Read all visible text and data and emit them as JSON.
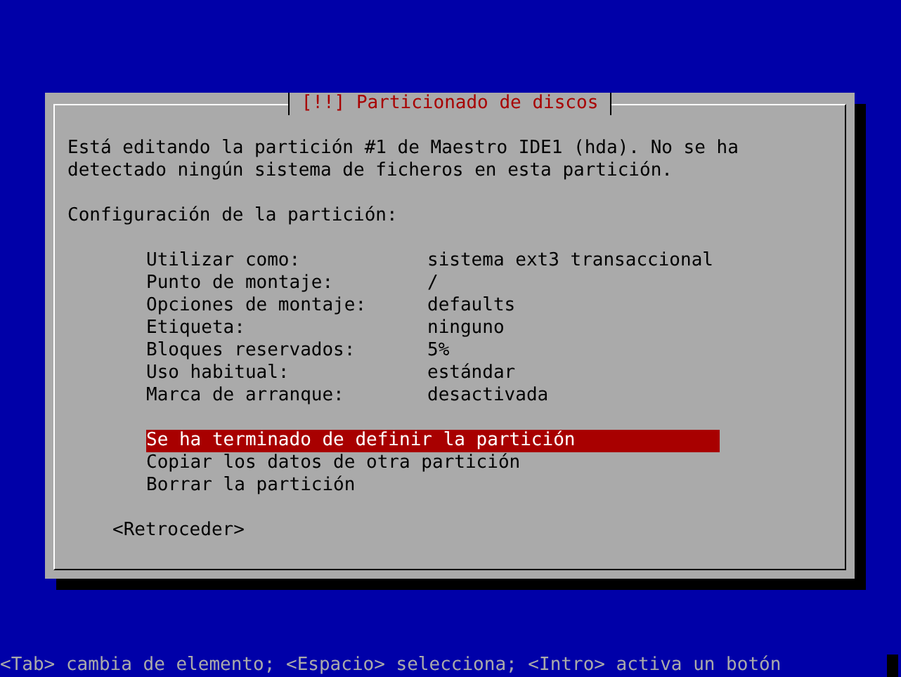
{
  "dialog": {
    "title": "[!!] Particionado de discos",
    "message": "Está editando la partición #1 de Maestro IDE1 (hda). No se ha\ndetectado ningún sistema de ficheros en esta partición.",
    "section_label": "Configuración de la partición:",
    "settings": [
      {
        "label": "Utilizar como:",
        "value": "sistema ext3 transaccional"
      },
      {
        "label": "Punto de montaje:",
        "value": "/"
      },
      {
        "label": "Opciones de montaje:",
        "value": "defaults"
      },
      {
        "label": "Etiqueta:",
        "value": "ninguno"
      },
      {
        "label": "Bloques reservados:",
        "value": "5%"
      },
      {
        "label": "Uso habitual:",
        "value": "estándar"
      },
      {
        "label": "Marca de arranque:",
        "value": "desactivada"
      }
    ],
    "actions": [
      {
        "label": "Se ha terminado de definir la partición",
        "selected": true
      },
      {
        "label": "Copiar los datos de otra partición",
        "selected": false
      },
      {
        "label": "Borrar la partición",
        "selected": false
      }
    ],
    "back_button": "<Retroceder>"
  },
  "help_text": "<Tab> cambia de elemento; <Espacio> selecciona; <Intro> activa un botón"
}
